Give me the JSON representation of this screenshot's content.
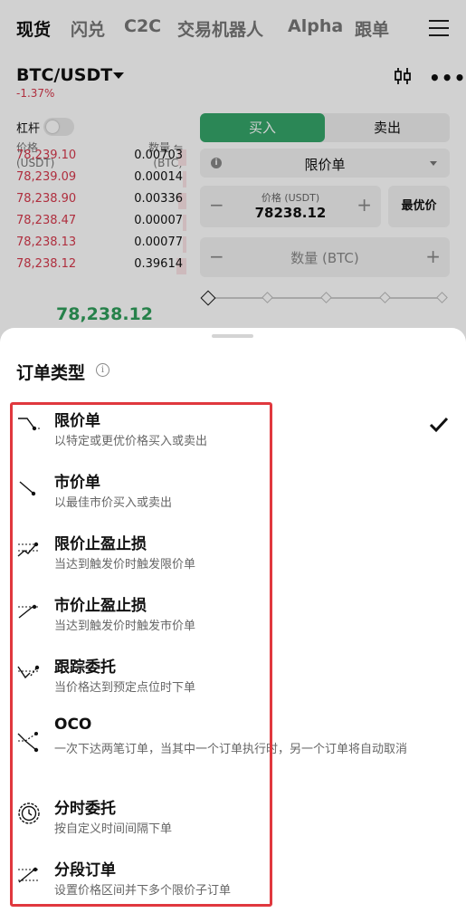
{
  "nav": {
    "tabs": [
      {
        "label": "现货",
        "active": true
      },
      {
        "label": "闪兑",
        "active": false
      },
      {
        "label": "C2C",
        "active": false
      },
      {
        "label": "交易机器人",
        "active": false
      },
      {
        "label": "Alpha",
        "active": false
      },
      {
        "label": "跟单",
        "active": false
      }
    ]
  },
  "market": {
    "pair": "BTC/USDT",
    "change": "-1.37%",
    "leverage_label": "杠杆"
  },
  "orderbook": {
    "price_header": "价格",
    "price_unit": "(USDT)",
    "qty_header": "数量 ⇋",
    "qty_unit": "(BTC)",
    "asks": [
      {
        "price": "78,239.10",
        "qty": "0.00703",
        "depth": 0.05
      },
      {
        "price": "78,239.09",
        "qty": "0.00014",
        "depth": 0.02
      },
      {
        "price": "78,238.90",
        "qty": "0.00336",
        "depth": 0.05
      },
      {
        "price": "78,238.47",
        "qty": "0.00007",
        "depth": 0.02
      },
      {
        "price": "78,238.13",
        "qty": "0.00077",
        "depth": 0.02
      },
      {
        "price": "78,238.12",
        "qty": "0.39614",
        "depth": 0.06
      }
    ],
    "last_price": "78,238.12"
  },
  "form": {
    "buy_label": "买入",
    "sell_label": "卖出",
    "order_type": "限价单",
    "price_label": "价格 (USDT)",
    "price_value": "78238.12",
    "best_price_label": "最优价",
    "qty_placeholder": "数量 (BTC)",
    "minus": "−",
    "plus": "+"
  },
  "sheet": {
    "title": "订单类型",
    "info_glyph": "i",
    "selected_index": 0,
    "options": [
      {
        "name": "限价单",
        "desc": "以特定或更优价格买入或卖出",
        "icon": "limit-order-icon"
      },
      {
        "name": "市价单",
        "desc": "以最佳市价买入或卖出",
        "icon": "market-order-icon"
      },
      {
        "name": "限价止盈止损",
        "desc": "当达到触发价时触发限价单",
        "icon": "limit-tpsl-icon"
      },
      {
        "name": "市价止盈止损",
        "desc": "当达到触发价时触发市价单",
        "icon": "market-tpsl-icon"
      },
      {
        "name": "跟踪委托",
        "desc": "当价格达到预定点位时下单",
        "icon": "trailing-order-icon"
      },
      {
        "name": "OCO",
        "desc": "一次下达两笔订单，当其中一个订单执行时，另一个订单将自动取消",
        "icon": "oco-icon"
      },
      {
        "name": "分时委托",
        "desc": "按自定义时间间隔下单",
        "icon": "twap-clock-icon"
      },
      {
        "name": "分段订单",
        "desc": "设置价格区间并下多个限价子订单",
        "icon": "scaled-order-icon"
      }
    ]
  },
  "colors": {
    "sell_red": "#d6394c",
    "buy_green": "#35a56a",
    "highlight_red": "#e0383e"
  }
}
